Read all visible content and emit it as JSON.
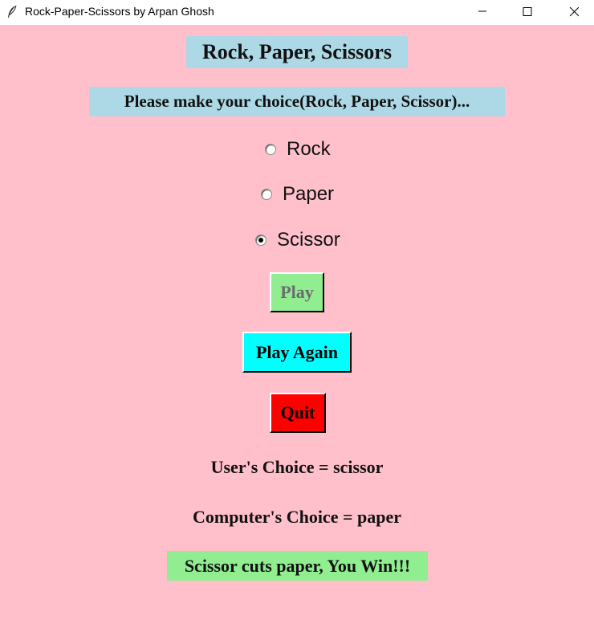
{
  "window": {
    "title": "Rock-Paper-Scissors by Arpan Ghosh",
    "icon": "feather-icon"
  },
  "app": {
    "heading": "Rock, Paper, Scissors",
    "prompt": "Please make your choice(Rock, Paper, Scissor)...",
    "options": [
      {
        "label": "Rock",
        "selected": false
      },
      {
        "label": "Paper",
        "selected": false
      },
      {
        "label": "Scissor",
        "selected": true
      }
    ],
    "buttons": {
      "play": "Play",
      "play_again": "Play Again",
      "quit": "Quit"
    },
    "user_choice": "User's Choice = scissor",
    "computer_choice": "Computer's Choice = paper",
    "outcome": "Scissor cuts paper, You Win!!!"
  },
  "colors": {
    "background": "#ffc0cb",
    "label_bg": "#add8e6",
    "play_bg": "#90ee90",
    "play_again_bg": "#00ffff",
    "quit_bg": "#ff0000",
    "outcome_bg": "#90ee90"
  }
}
